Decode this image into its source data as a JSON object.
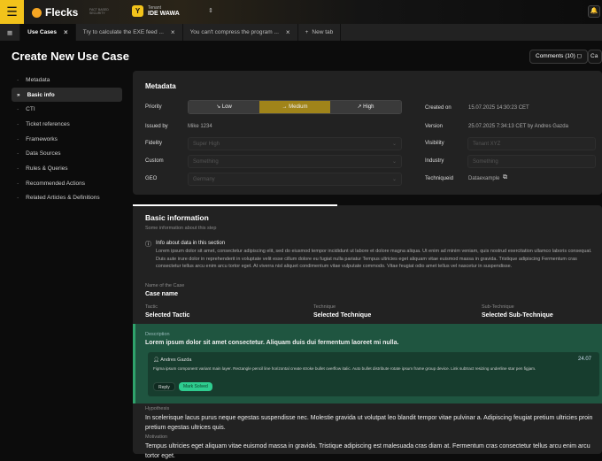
{
  "header": {
    "app_name": "Flecks",
    "tagline": "FACT BASED SECURITY",
    "tenant_label": "Tenant",
    "tenant_name": "IDE WAWA"
  },
  "tabs": [
    {
      "label": "Use Cases",
      "active": true
    },
    {
      "label": "Try to calculate the EXE feed ..."
    },
    {
      "label": "You can't compress the program ..."
    },
    {
      "label": "New tab"
    }
  ],
  "page": {
    "title": "Create New Use Case",
    "comments_label": "Comments (10)",
    "cut_button": "Ca"
  },
  "sidebar": {
    "items": [
      "Metadata",
      "Basic info",
      "CTI",
      "Ticket references",
      "Frameworks",
      "Data Sources",
      "Rules & Queries",
      "Recommended Actions",
      "Related Articles & Definitions"
    ],
    "active": "Basic info"
  },
  "metadata": {
    "title": "Metadata",
    "priority_label": "Priority",
    "priority_options": [
      "Low",
      "Medium",
      "High"
    ],
    "priority_selected": "Medium",
    "issued_by_label": "Issued by",
    "issued_by": "Mike 1234",
    "fidelity_label": "Fidelity",
    "fidelity": "Super High",
    "custom_label": "Custom",
    "custom": "Something",
    "geo_label": "GEO",
    "geo": "Germany",
    "created_on_label": "Created on",
    "created_on": "15.07.2025 14:30:23 CET",
    "version_label": "Version",
    "version": "25.07.2025 7:34:13 CET by Andres Gazda",
    "visibility_label": "Visibility",
    "visibility": "Tenant XYZ",
    "industry_label": "Industry",
    "industry": "Something",
    "techniqueid_label": "Techniqueid",
    "techniqueid": "Dataexample"
  },
  "basic": {
    "title": "Basic information",
    "subtitle": "Some information about this step",
    "info_title": "Info about data in this section",
    "info_text": "Lorem ipsum dolor sit amet, consectetur adipiscing elit, sed do eiusmod tempor incididunt ut labore et dolore magna aliqua. Ut enim ad minim veniam, quis nostrud exercitation ullamco laboris consequat. Duis aute irure dolor in reprehenderit in voluptate velit esse cillum dolore eu fugiat nulla pariatur Tempus ultricies eget aliquam vitae euismod massa in gravida. Tristique adipiscing Fermentum cras consectetur tellus arcu enim arcu tortor eget. At viverra nisl aliquet condimentum vitae vulputate commodo. Vitae feugiat odio amet tellus vel nascetur in suspendisse.",
    "case_label": "Name of the Case",
    "case_value": "Case name",
    "tactic_label": "Tactic",
    "tactic_value": "Selected Tactic",
    "technique_label": "Technique",
    "technique_value": "Selected Technique",
    "subtech_label": "Sub-Technique",
    "subtech_value": "Selected Sub-Technique",
    "desc_label": "Description",
    "desc_value": "Lorem ipsum dolor sit amet consectetur. Aliquam duis dui fermentum laoreet mi nulla.",
    "comment": {
      "author": "Andres Gazda",
      "date": "24.07",
      "text": "Figma ipsum component variant main layer. Rectangle pencil line horizontal create stroke bullet overflow italic. Auto bullet distribute rotate ipsum frame group device. Link subtract resizing underline star pen figjam.",
      "reply": "Reply",
      "resolve": "Mark Solved"
    },
    "hyp_label": "Hypothesis",
    "hyp_value": "In scelerisque lacus purus neque egestas suspendisse nec. Molestie gravida ut volutpat leo blandit tempor vitae pulvinar a. Adipiscing feugiat pretium ultricies proin pretium egestas ultrices quis.",
    "mot_label": "Motivation",
    "mot_value": "Tempus ultricies eget aliquam vitae euismod massa in gravida. Tristique adipiscing est malesuada cras diam at. Fermentum cras consectetur tellus arcu enim arcu tortor eget."
  },
  "colors": {
    "accent": "#f2c31b",
    "priority_selected": "#a0841a",
    "highlight": "#1f5540",
    "success": "#2ecc8f"
  }
}
